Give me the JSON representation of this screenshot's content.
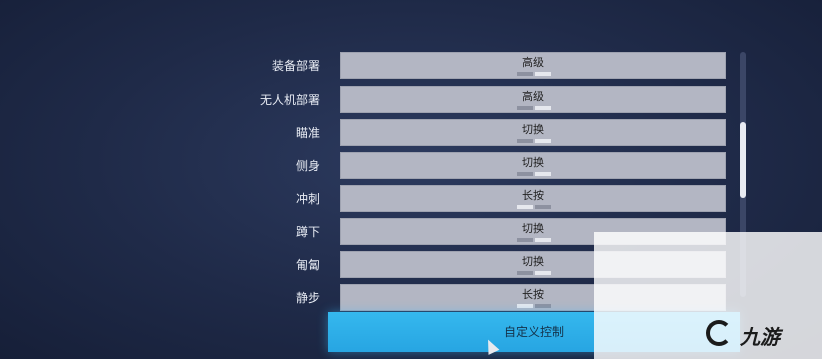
{
  "settings": [
    {
      "label": "装备部署",
      "value": "高级",
      "indicator": "second"
    },
    {
      "label": "无人机部署",
      "value": "高级",
      "indicator": "second"
    },
    {
      "label": "瞄准",
      "value": "切换",
      "indicator": "second"
    },
    {
      "label": "侧身",
      "value": "切换",
      "indicator": "second"
    },
    {
      "label": "冲刺",
      "value": "长按",
      "indicator": "first"
    },
    {
      "label": "蹲下",
      "value": "切换",
      "indicator": "second"
    },
    {
      "label": "匍匐",
      "value": "切换",
      "indicator": "second"
    },
    {
      "label": "静步",
      "value": "长按",
      "indicator": "first"
    }
  ],
  "custom_control_button": "自定义控制",
  "watermark": {
    "text": "九游"
  },
  "colors": {
    "button": "#2eb0ea",
    "field": "#b3b6c3",
    "background": "#1f2a48"
  }
}
